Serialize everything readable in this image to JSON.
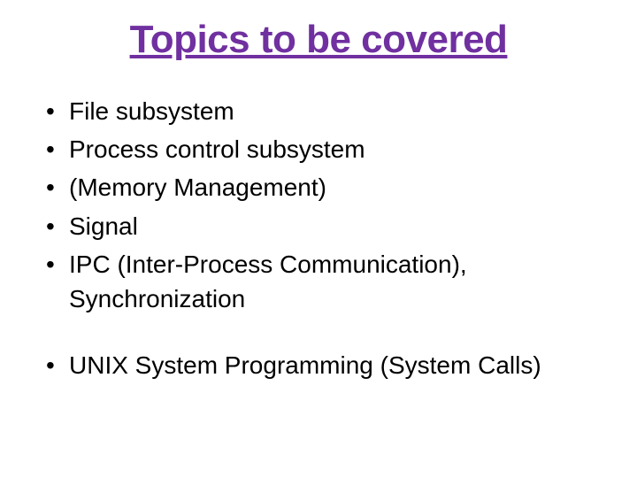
{
  "title": "Topics to be covered",
  "bullets_group1": [
    "File subsystem",
    "Process control subsystem",
    "(Memory Management)",
    "Signal",
    "IPC (Inter-Process Communication), Synchronization"
  ],
  "bullets_group2": [
    "UNIX System Programming (System Calls)"
  ]
}
